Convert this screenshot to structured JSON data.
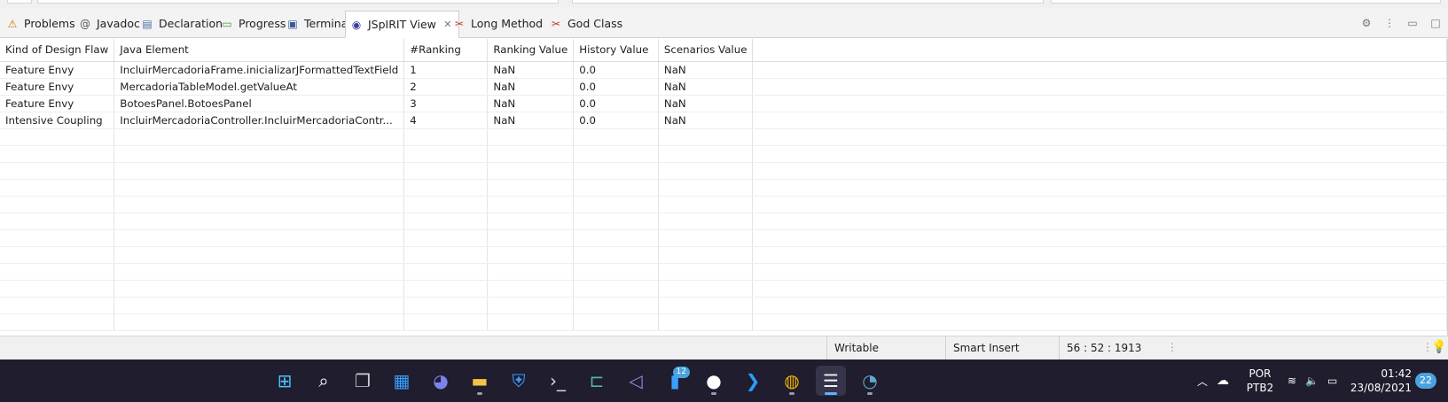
{
  "tabs": [
    {
      "label": "Problems",
      "icon": "problems-icon",
      "glyph": "⚠",
      "color": "#c57b00"
    },
    {
      "label": "Javadoc",
      "icon": "javadoc-icon",
      "glyph": "@",
      "color": "#555555"
    },
    {
      "label": "Declaration",
      "icon": "declaration-icon",
      "glyph": "▤",
      "color": "#4a6fa5"
    },
    {
      "label": "Progress",
      "icon": "progress-icon",
      "glyph": "▭",
      "color": "#3c9a3c"
    },
    {
      "label": "Terminal",
      "icon": "terminal-icon",
      "glyph": "▣",
      "color": "#3b5998"
    },
    {
      "label": "JSpIRIT View",
      "icon": "jspirit-icon",
      "glyph": "◉",
      "color": "#3a3f9e",
      "active": true
    },
    {
      "label": "Long Method",
      "icon": "long-method-icon",
      "glyph": "✂",
      "color": "#c0392b"
    },
    {
      "label": "God Class",
      "icon": "god-class-icon",
      "glyph": "✂",
      "color": "#c0392b"
    }
  ],
  "table": {
    "columns": [
      "Kind of Design Flaw",
      "Java Element",
      "#Ranking",
      "Ranking Value",
      "History Value",
      "Scenarios Value"
    ],
    "rows": [
      [
        "Feature Envy",
        "IncluirMercadoriaFrame.inicializarJFormattedTextField",
        "1",
        "NaN",
        "0.0",
        "NaN"
      ],
      [
        "Feature Envy",
        "MercadoriaTableModel.getValueAt",
        "2",
        "NaN",
        "0.0",
        "NaN"
      ],
      [
        "Feature Envy",
        "BotoesPanel.BotoesPanel",
        "3",
        "NaN",
        "0.0",
        "NaN"
      ],
      [
        "Intensive Coupling",
        "IncluirMercadoriaController.IncluirMercadoriaContr...",
        "4",
        "NaN",
        "0.0",
        "NaN"
      ]
    ],
    "empty_rows": 12
  },
  "status": {
    "writable": "Writable",
    "insert_mode": "Smart Insert",
    "cursor": "56 : 52 : 1913"
  },
  "taskbar": {
    "apps": [
      {
        "name": "windows-start-icon",
        "glyph": "⊞",
        "color": "#4cc2ff"
      },
      {
        "name": "search-icon",
        "glyph": "⌕",
        "color": "#ffffff"
      },
      {
        "name": "task-view-icon",
        "glyph": "❐",
        "color": "#cfcfcf"
      },
      {
        "name": "widgets-icon",
        "glyph": "▦",
        "color": "#3aa0ff"
      },
      {
        "name": "teams-chat-icon",
        "glyph": "◕",
        "color": "#7b83eb"
      },
      {
        "name": "file-explorer-icon",
        "glyph": "▬",
        "color": "#f6c343",
        "dot": true
      },
      {
        "name": "store-icon",
        "glyph": "⛨",
        "color": "#3aa0ff"
      },
      {
        "name": "windows-terminal-icon",
        "glyph": "›_",
        "color": "#dddddd"
      },
      {
        "name": "eclipse-che-icon",
        "glyph": "⊏",
        "color": "#4db6ac"
      },
      {
        "name": "visual-studio-icon",
        "glyph": "◁",
        "color": "#a97fe0"
      },
      {
        "name": "notes-icon",
        "glyph": "▮",
        "color": "#3aa0ff",
        "badge": "12"
      },
      {
        "name": "github-icon",
        "glyph": "●",
        "color": "#ffffff",
        "dot": true
      },
      {
        "name": "vscode-icon",
        "glyph": "❯",
        "color": "#2d9cfa"
      },
      {
        "name": "chrome-icon",
        "glyph": "◍",
        "color": "#f4b400",
        "dot": true
      },
      {
        "name": "eclipse-icon",
        "glyph": "☰",
        "color": "#f0f0f0",
        "active": true
      },
      {
        "name": "app-icon",
        "glyph": "◔",
        "color": "#5fa8d3",
        "dot": true
      }
    ],
    "tray": {
      "language": "POR",
      "layout": "PTB2",
      "time": "01:42",
      "date": "23/08/2021",
      "notifications": "22"
    }
  }
}
